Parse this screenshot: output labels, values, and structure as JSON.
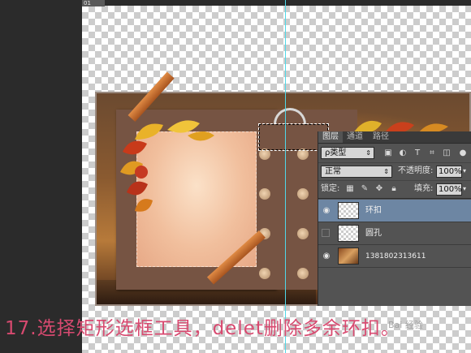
{
  "canvas": {
    "ruler_tag": "01",
    "guide_color": "#4fd8e8"
  },
  "layers_panel": {
    "tabs": [
      {
        "label": "图层",
        "active": true
      },
      {
        "label": "通道",
        "active": false
      },
      {
        "label": "路径",
        "active": false
      }
    ],
    "filter": {
      "label": "ρ类型",
      "arrow": "⇕"
    },
    "filter_icons": [
      "image-filter-icon",
      "adjustment-filter-icon",
      "type-filter-icon",
      "shape-filter-icon",
      "smart-object-filter-icon"
    ],
    "blend_mode": {
      "value": "正常",
      "arrow": "⇕"
    },
    "opacity": {
      "label": "不透明度:",
      "value": "100%",
      "arrow": "▾"
    },
    "lock": {
      "label": "锁定:"
    },
    "fill": {
      "label": "填充:",
      "value": "100%",
      "arrow": "▾"
    },
    "layers": [
      {
        "name": "环扣",
        "visible": true,
        "selected": true,
        "thumb": "transparent"
      },
      {
        "name": "圆孔",
        "visible": false,
        "selected": false,
        "thumb": "transparent"
      },
      {
        "name": "1381802313611",
        "visible": true,
        "selected": false,
        "thumb": "photo"
      }
    ]
  },
  "caption": "17.选择矩形选框工具，delet删除多余环扣。",
  "watermark": "Bai  经验"
}
